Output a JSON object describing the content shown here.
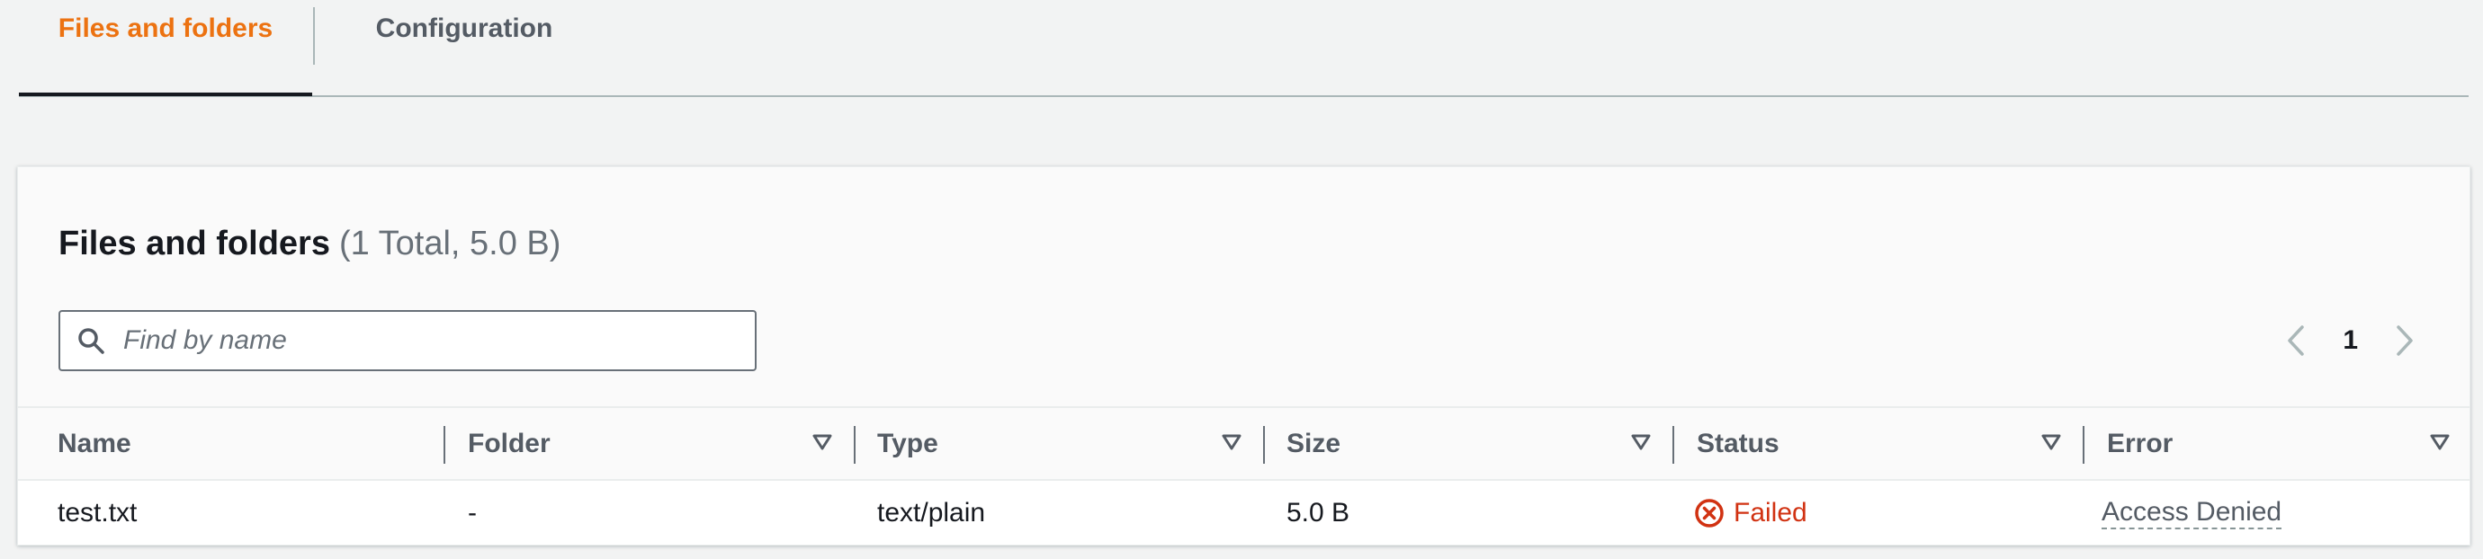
{
  "tabs": [
    {
      "label": "Files and folders",
      "active": true
    },
    {
      "label": "Configuration",
      "active": false
    }
  ],
  "panel": {
    "title": "Files and folders",
    "count": "(1 Total, 5.0 B)",
    "search": {
      "placeholder": "Find by name",
      "value": ""
    },
    "pagination": {
      "current_page": "1"
    }
  },
  "table": {
    "columns": [
      "Name",
      "Folder",
      "Type",
      "Size",
      "Status",
      "Error"
    ],
    "rows": [
      {
        "name": "test.txt",
        "folder": "-",
        "type": "text/plain",
        "size": "5.0 B",
        "status": "Failed",
        "error": "Access Denied"
      }
    ]
  },
  "colors": {
    "accent": "#ec7211",
    "error": "#d13212",
    "text": "#16191f",
    "muted": "#545b64",
    "background": "#f2f3f3"
  },
  "icons": {
    "search": "search-icon",
    "prev": "chevron-left-icon",
    "next": "chevron-right-icon",
    "sort": "sort-caret-down-icon",
    "status_failed": "status-negative-icon"
  }
}
